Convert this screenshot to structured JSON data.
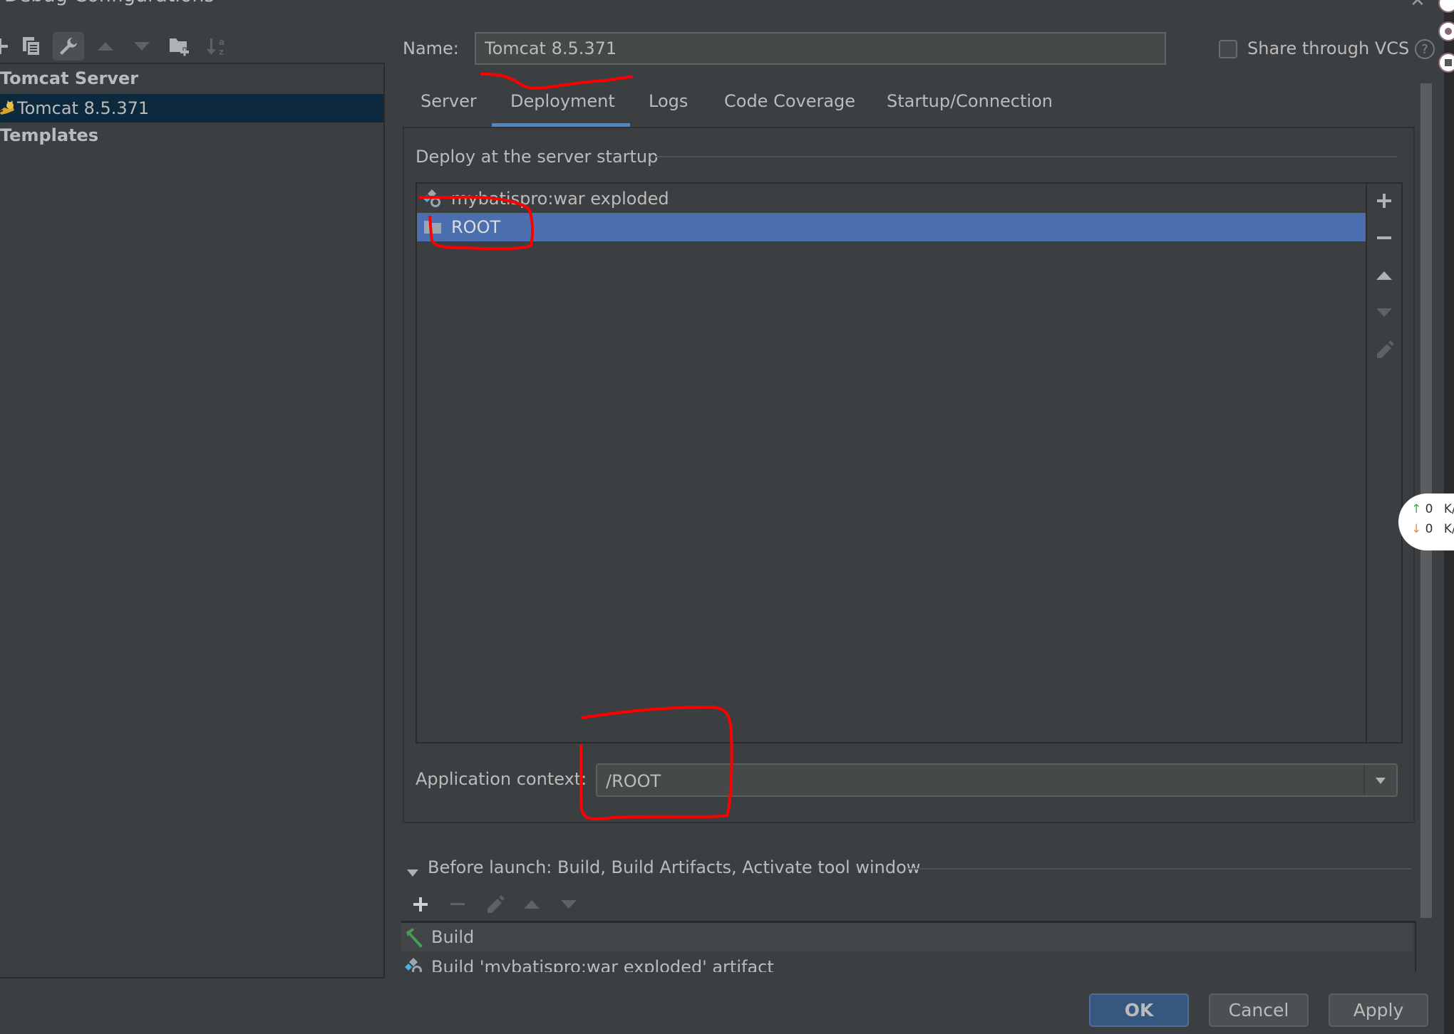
{
  "window": {
    "title": "Debug Configurations",
    "close_icon": "close-icon"
  },
  "toolbar": {
    "items": [
      {
        "name": "add",
        "icon": "plus-icon"
      },
      {
        "name": "copy",
        "icon": "copy-icon"
      },
      {
        "name": "edit-defaults",
        "icon": "wrench-icon",
        "active": true
      },
      {
        "name": "move-up",
        "icon": "arrow-up-icon"
      },
      {
        "name": "move-down",
        "icon": "arrow-down-icon"
      },
      {
        "name": "new-folder",
        "icon": "folder-add-icon"
      },
      {
        "name": "sort",
        "icon": "sort-alpha-icon"
      }
    ]
  },
  "tree": {
    "group_label": "Tomcat Server",
    "selected_item": {
      "label": "Tomcat 8.5.371",
      "icon": "tomcat-icon"
    },
    "templates_label": "Templates"
  },
  "form": {
    "name_label": "Name:",
    "name_value": "Tomcat 8.5.371",
    "share_label": "Share through VCS",
    "share_checked": false,
    "help_glyph": "?"
  },
  "tabs": [
    {
      "label": "Server",
      "active": false
    },
    {
      "label": "Deployment",
      "active": true
    },
    {
      "label": "Logs",
      "active": false
    },
    {
      "label": "Code Coverage",
      "active": false
    },
    {
      "label": "Startup/Connection",
      "active": false
    }
  ],
  "deployment": {
    "section_title": "Deploy at the server startup",
    "items": [
      {
        "label": "mybatispro:war exploded",
        "icon": "artifact-icon",
        "selected": false
      },
      {
        "label": "ROOT",
        "icon": "folder-icon",
        "selected": true
      }
    ],
    "side_buttons": [
      "plus-icon",
      "minus-icon",
      "arrow-up-icon",
      "arrow-down-icon",
      "pencil-icon"
    ],
    "app_context_label": "Application context:",
    "app_context_value": "/ROOT"
  },
  "before_launch": {
    "title": "Before launch: Build, Build Artifacts, Activate tool window",
    "toolbar": [
      "plus-icon",
      "minus-icon",
      "pencil-icon",
      "arrow-up-icon",
      "arrow-down-icon"
    ],
    "items": [
      {
        "label": "Build",
        "icon": "hammer-icon"
      },
      {
        "label": "Build 'mybatispro:war exploded' artifact",
        "icon": "artifact-icon"
      }
    ]
  },
  "buttons": {
    "ok": "OK",
    "cancel": "Cancel",
    "apply": "Apply"
  },
  "network_widget": {
    "upload_value": "0",
    "upload_unit": "K/",
    "download_value": "0",
    "download_unit": "K/"
  },
  "colors": {
    "background": "#3c3f41",
    "selection_tree": "#0d293e",
    "selection_list": "#4b6eaf",
    "tab_underline": "#4a88c7",
    "ok_button": "#365880",
    "annotation_red": "#ff0000"
  }
}
